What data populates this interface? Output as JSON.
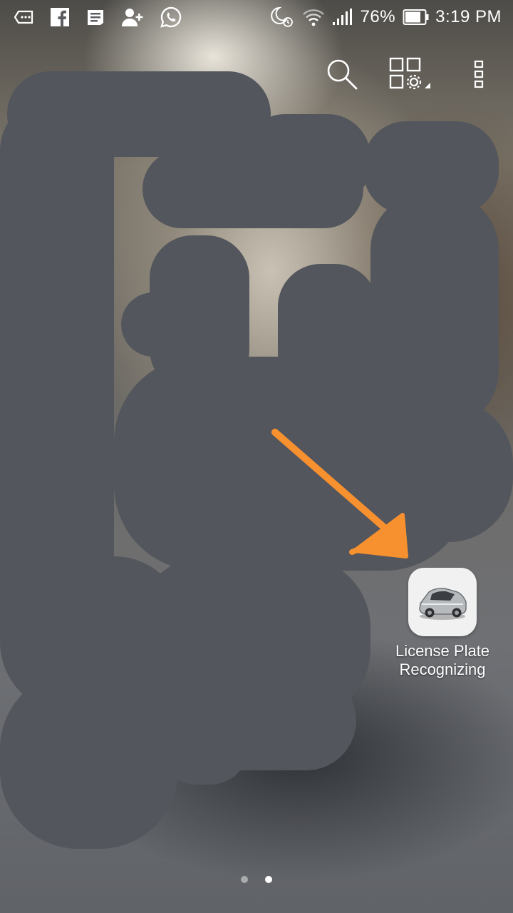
{
  "status_bar": {
    "left_icons": [
      "message-bubble-icon",
      "facebook-icon",
      "news-icon",
      "add-contact-icon",
      "whatsapp-icon"
    ],
    "right_icons": [
      "night-alarm-icon",
      "wifi-icon",
      "signal-icon",
      "battery-icon"
    ],
    "battery_percent": "76%",
    "time": "3:19 PM"
  },
  "top_actions": {
    "search_icon": "search-icon",
    "manage_icon": "manage-home-icon",
    "menu_icon": "more-vert-icon"
  },
  "annotation": {
    "color": "#f7902f"
  },
  "app": {
    "label_line1": "License Plate",
    "label_line2": "Recognizing",
    "icon": "car-icon"
  },
  "pager": {
    "pages": 2,
    "active_index": 1
  }
}
